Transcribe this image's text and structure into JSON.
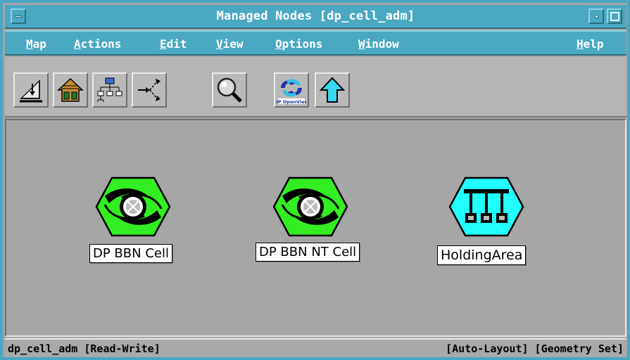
{
  "window": {
    "title": "Managed Nodes [dp_cell_adm]"
  },
  "menu": [
    {
      "label": "Map",
      "mnemonic_index": 0
    },
    {
      "label": "Actions",
      "mnemonic_index": 0
    },
    {
      "label": "Edit",
      "mnemonic_index": 0
    },
    {
      "label": "View",
      "mnemonic_index": 0
    },
    {
      "label": "Options",
      "mnemonic_index": 0
    },
    {
      "label": "Window",
      "mnemonic_index": 0
    },
    {
      "label": "Help",
      "mnemonic_index": 0
    }
  ],
  "toolbar": {
    "buttons": [
      {
        "name": "close-submap-icon"
      },
      {
        "name": "home-submap-icon"
      },
      {
        "name": "root-submap-icon"
      },
      {
        "name": "navigate-submap-icon"
      },
      {
        "name": "quick-navigator-icon"
      },
      {
        "name": "hp-openview-icon",
        "caption": "HP OpenView"
      },
      {
        "name": "parent-submap-icon"
      }
    ]
  },
  "nodes": [
    {
      "label": "DP BBN Cell",
      "icon": "cell-icon",
      "color": "#33ee22"
    },
    {
      "label": "DP BBN NT Cell",
      "icon": "cell-icon",
      "color": "#33ee22"
    },
    {
      "label": "HoldingArea",
      "icon": "holding-area-icon",
      "color": "#22ffff"
    }
  ],
  "status": {
    "left": "dp_cell_adm [Read-Write]",
    "right": "[Auto-Layout] [Geometry Set]"
  },
  "colors": {
    "frame": "#4aa8c2",
    "map_background": "#a6a6a6",
    "cell_symbol": "#33ee22",
    "holding_symbol": "#22ffff"
  }
}
